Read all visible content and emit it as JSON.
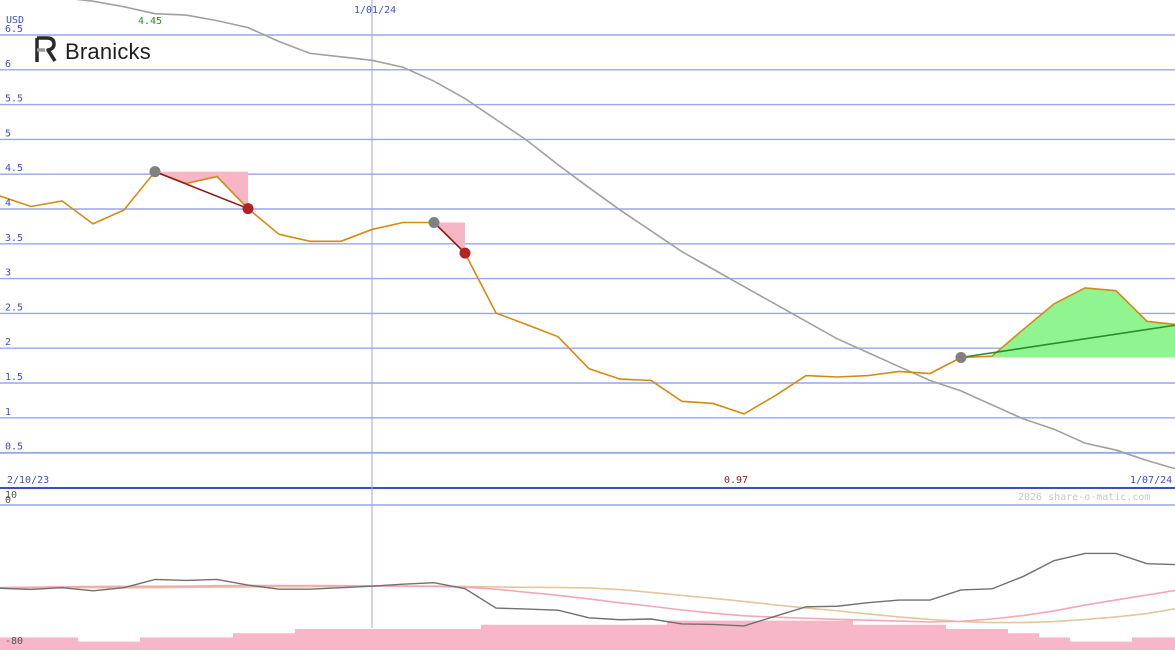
{
  "brand": {
    "name": "Branicks",
    "logo_icon": "branicks-logo-icon"
  },
  "watermark": "2026 share-o-matic.com",
  "colors": {
    "grid": "#9aa6ee",
    "axis_text": "#3b4fc9",
    "price": "#d48a10",
    "long_ma": "#a0a0a0",
    "loss_fill": "#f7b6c6",
    "gain_fill": "#90f590",
    "loss_line": "#8b1a1a",
    "gain_line": "#2b8c2b",
    "oscillator": "#707070",
    "osc_fast": "#f4a6b9",
    "osc_slow": "#e3c69b",
    "volume": "#f8b7c9",
    "peak_label": "#2b8c2b",
    "trough_label": "#8b1a1a"
  },
  "chart_data": [
    {
      "type": "line",
      "unit_label": "USD",
      "ylim": [
        0,
        6.5
      ],
      "y_ticks": [
        "0.5",
        "1",
        "1.5",
        "2",
        "2.5",
        "3",
        "3.5",
        "4",
        "4.5",
        "5",
        "5.5",
        "6",
        "6.5"
      ],
      "x_labels": {
        "start": "2/10/23",
        "marker": "1/01/24",
        "end": "1/07/24"
      },
      "peak_label": "4.45",
      "trough_label": "0.97",
      "series": [
        {
          "role": "price",
          "values": [
            4.1,
            3.95,
            4.03,
            3.7,
            3.9,
            4.45,
            4.28,
            4.38,
            3.92,
            3.55,
            3.45,
            3.45,
            3.62,
            3.72,
            3.72,
            3.28,
            2.42,
            2.25,
            2.08,
            1.62,
            1.47,
            1.45,
            1.15,
            1.12,
            0.97,
            1.23,
            1.52,
            1.5,
            1.52,
            1.58,
            1.55,
            1.78,
            1.8,
            2.18,
            2.55,
            2.78,
            2.74,
            2.3,
            2.25
          ]
        },
        {
          "role": "moving-average",
          "values": [
            7.1,
            7.0,
            6.95,
            6.9,
            6.82,
            6.72,
            6.7,
            6.62,
            6.52,
            6.32,
            6.15,
            6.1,
            6.05,
            5.95,
            5.75,
            5.5,
            5.2,
            4.9,
            4.55,
            4.22,
            3.9,
            3.6,
            3.3,
            3.05,
            2.8,
            2.55,
            2.3,
            2.05,
            1.85,
            1.65,
            1.45,
            1.3,
            1.1,
            0.9,
            0.75,
            0.55,
            0.45,
            0.3,
            0.17,
            0.05
          ]
        }
      ],
      "trades": [
        {
          "result": "loss",
          "entry": {
            "i": 5,
            "price": 4.45
          },
          "exit": {
            "i": 8,
            "price": 3.92
          }
        },
        {
          "result": "loss",
          "entry": {
            "i": 14,
            "price": 3.72
          },
          "exit": {
            "i": 15,
            "price": 3.28
          }
        },
        {
          "result": "gain",
          "entry": {
            "i": 31,
            "price": 1.78
          },
          "exit": {
            "i": 38,
            "price": 2.25
          }
        }
      ]
    },
    {
      "type": "line",
      "y_ticks": [
        "10",
        "0",
        "-80"
      ],
      "series": [
        {
          "role": "oscillator",
          "values": [
            -45.5,
            -46.3,
            -45.1,
            -47.2,
            -45.1,
            -39.6,
            -40.3,
            -39.6,
            -43.4,
            -46.1,
            -46.1,
            -45.1,
            -44.1,
            -42.8,
            -41.8,
            -45.8,
            -58.7,
            -59.4,
            -60.1,
            -65.2,
            -66.5,
            -66,
            -69.3,
            -69.6,
            -70.6,
            -64.2,
            -57.9,
            -57.5,
            -55.1,
            -53.4,
            -53.4,
            -46.6,
            -45.9,
            -37.7,
            -27.1,
            -22.3,
            -22.3,
            -29.1,
            -29.8
          ]
        },
        {
          "role": "oscillator-fast",
          "values": [
            -45.1,
            -44.8,
            -44.5,
            -44.4,
            -44.3,
            -44.2,
            -44.1,
            -43.8,
            -43.7,
            -43.7,
            -43.7,
            -43.8,
            -43.9,
            -44.1,
            -44.3,
            -44.8,
            -46.1,
            -48.2,
            -50.2,
            -52.6,
            -55.2,
            -57.5,
            -60,
            -62.1,
            -63.9,
            -64.8,
            -65.5,
            -66.2,
            -66.8,
            -67.4,
            -68,
            -67.5,
            -66,
            -63.7,
            -60.6,
            -56.7,
            -53.3,
            -50,
            -46.6
          ]
        },
        {
          "role": "oscillator-slow",
          "values": [
            -45.1,
            -45.2,
            -45.1,
            -45.1,
            -45.1,
            -45.1,
            -44.9,
            -44.7,
            -44.6,
            -44.5,
            -44.5,
            -44.3,
            -44.1,
            -44,
            -44,
            -44.4,
            -44.6,
            -44.9,
            -45,
            -45.3,
            -46.4,
            -48.3,
            -50.3,
            -52.2,
            -54.3,
            -56.6,
            -58.6,
            -60.5,
            -62.6,
            -64.6,
            -66.3,
            -67.7,
            -68.4,
            -68.4,
            -67.7,
            -66.4,
            -64.6,
            -62.4,
            -58.9
          ]
        },
        {
          "role": "volume",
          "values": [
            3,
            3,
            3,
            2,
            2,
            3,
            3,
            3,
            4,
            4,
            5,
            5,
            5,
            5,
            5,
            5,
            6,
            6,
            6,
            6,
            6,
            6,
            7,
            7,
            7,
            7,
            7,
            7,
            6,
            6,
            6,
            5,
            5,
            4,
            3,
            2,
            2,
            3,
            3
          ]
        }
      ]
    }
  ]
}
